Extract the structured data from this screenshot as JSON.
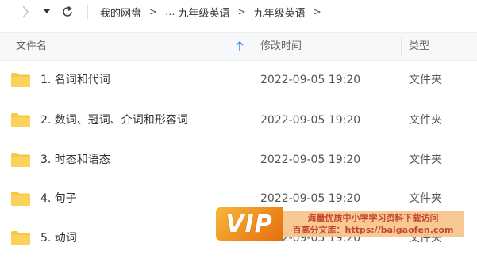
{
  "nav": {
    "breadcrumb": [
      "我的网盘",
      "...",
      "九年级英语",
      "九年级英语"
    ],
    "separator": ">"
  },
  "columns": {
    "name": "文件名",
    "modified": "修改时间",
    "type": "类型"
  },
  "files": [
    {
      "name": "1. 名词和代词",
      "modified": "2022-09-05 19:20",
      "type": "文件夹"
    },
    {
      "name": "2. 数词、冠词、介词和形容词",
      "modified": "2022-09-05 19:20",
      "type": "文件夹"
    },
    {
      "name": "3. 时态和语态",
      "modified": "2022-09-05 19:20",
      "type": "文件夹"
    },
    {
      "name": "4. 句子",
      "modified": "2022-09-05 19:20",
      "type": "文件夹"
    },
    {
      "name": "5. 动词",
      "modified": "2022-09-05 19:20",
      "type": "文件夹"
    }
  ],
  "watermark": {
    "logo": "VIP",
    "line1": "海量优质中小学学习资料下载访问",
    "line2": "百高分文库：https://baigaofen.com"
  },
  "colors": {
    "folder": "#f7c746",
    "sort_accent": "#3b8cf0",
    "watermark_orange": "#ee8a1c"
  }
}
